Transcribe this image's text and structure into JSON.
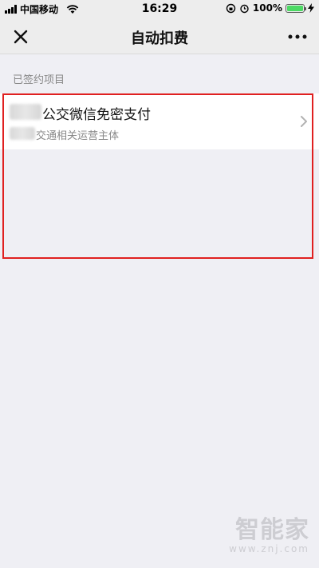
{
  "status_bar": {
    "carrier": "中国移动",
    "time": "16:29",
    "battery": "100%",
    "battery_level": 1.0
  },
  "nav": {
    "title": "自动扣费",
    "close_icon": "close-icon",
    "more_icon": "more-icon"
  },
  "section": {
    "label": "已签约项目"
  },
  "items": [
    {
      "title": "公交微信免密支付",
      "subtitle": "交通相关运营主体",
      "icon": "chevron-right-icon"
    }
  ],
  "watermark": {
    "main": "智能家",
    "sub": "www.znj.com"
  },
  "colors": {
    "highlight": "#e02020",
    "background": "#efeff4",
    "battery": "#4cd964"
  }
}
